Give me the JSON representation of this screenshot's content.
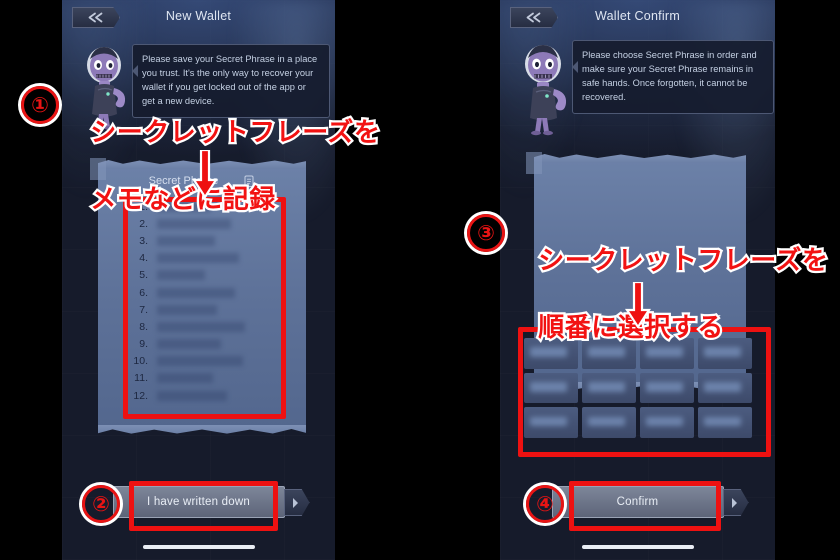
{
  "left_phone": {
    "header": {
      "title": "New Wallet",
      "back_icon": "back-chevron-icon"
    },
    "avatar_name": "alien-astronaut-avatar",
    "bubble_text": "Please save your Secret Phrase in a place you trust. It's the only way to recover your wallet if you get locked out of the app or get a new device.",
    "card": {
      "title": "Secret Phrase",
      "copy_icon": "copy-icon",
      "items": [
        "1.",
        "2.",
        "3.",
        "4.",
        "5.",
        "6.",
        "7.",
        "8.",
        "9.",
        "10.",
        "11.",
        "12."
      ],
      "blur_widths": [
        54,
        74,
        58,
        82,
        48,
        78,
        60,
        88,
        64,
        86,
        56,
        70
      ]
    },
    "cta_label": "I have written down",
    "cta_arrow_icon": "chevron-right-icon"
  },
  "right_phone": {
    "header": {
      "title": "Wallet Confirm",
      "back_icon": "back-chevron-icon"
    },
    "avatar_name": "alien-astronaut-avatar",
    "bubble_text": "Please choose Secret Phrase in order and make sure your Secret Phrase remains in safe hands. Once forgotten, it cannot be recovered.",
    "grid": {
      "rows": 3,
      "cols": 4,
      "cell_count": 12
    },
    "cta_label": "Confirm",
    "cta_arrow_icon": "chevron-right-icon"
  },
  "annotations": {
    "step1": {
      "marker": "①",
      "line1": "シークレットフレーズを",
      "line2": "メモなどに記録"
    },
    "step2": {
      "marker": "②"
    },
    "step3": {
      "marker": "③",
      "line1": "シークレットフレーズを",
      "line2": "順番に選択する"
    },
    "step4": {
      "marker": "④"
    },
    "accent_color": "#ee1111",
    "outline_color": "#ffffff"
  }
}
